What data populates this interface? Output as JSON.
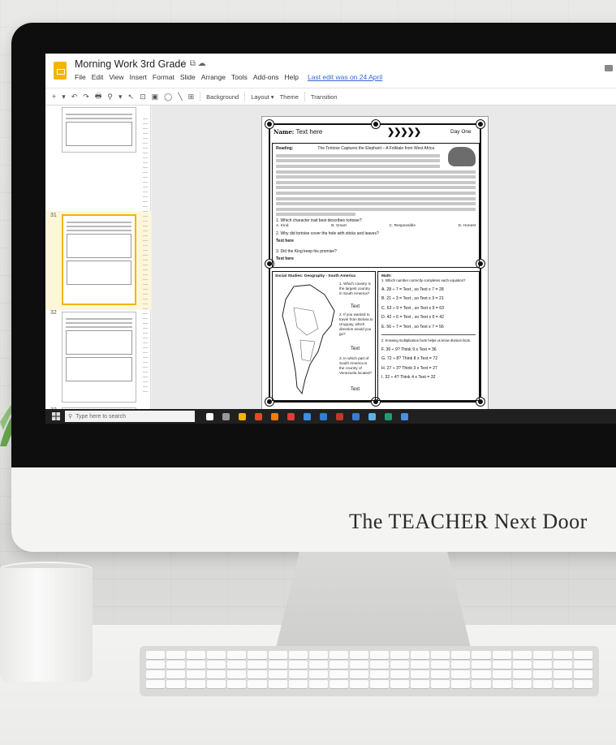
{
  "app": {
    "doc_title": "Morning Work 3rd Grade",
    "title_icons": "☆  ⧉  ☁",
    "menu": [
      "File",
      "Edit",
      "View",
      "Insert",
      "Format",
      "Slide",
      "Arrange",
      "Tools",
      "Add-ons",
      "Help"
    ],
    "last_edit": "Last edit was on 24 April"
  },
  "toolbar": {
    "icons": [
      "+",
      "▾",
      "↶",
      "↷",
      "🖶",
      "⚲",
      "▾",
      "↖",
      "⊡",
      "▣",
      "◯",
      "╲",
      "⊞"
    ],
    "background": "Background",
    "layout": "Layout ▾",
    "theme": "Theme",
    "transition": "Transition"
  },
  "filmstrip": {
    "slides": [
      {
        "number": "",
        "selected": false
      },
      {
        "number": "31",
        "selected": true
      },
      {
        "number": "32",
        "selected": false
      },
      {
        "number": "33",
        "selected": false
      }
    ],
    "view_icons": [
      "▬",
      "⊞"
    ]
  },
  "worksheet": {
    "name_label": "Name:",
    "name_value": "Text here",
    "arrows": "❯❯❯❯❯",
    "day": "Day One",
    "reading_label": "Reading:",
    "reading_title": "The Tortoise Captures the Elephant – A Folktale from West Africa",
    "q1": "1. Which character trait best describes tortoise?",
    "q1_choices": [
      "A. Kind",
      "B. Smart",
      "C. Responsible",
      "D. Honest"
    ],
    "q2": "2. Why did tortoise cover the hole with sticks and leaves?",
    "q2_answer": "Text here",
    "q3": "3. Did the King keep his promise?",
    "q3_answer": "Text here",
    "social_title": "Social Studies: Geography - South America",
    "social_q1": "1. Which country is the largest country in South America?",
    "social_q2": "2. If you wanted to travel from Bolivia to Uruguay, which direction would you go?",
    "social_q3": "3. In which part of South America is the country of Venezuela located?",
    "social_answer": "Text",
    "math_title": "Math:",
    "math_intro": "1. Which number correctly completes each equation?",
    "math_rows": [
      "A.  28 ÷ 7 = Text , so Text x 7 = 28",
      "B.  21 ÷ 3 = Text , so Text x 3 = 21",
      "C.  63 ÷ 9 = Text , so Text x 9 = 63",
      "D.  42 ÷ 6 = Text , so Text x 6 = 42",
      "E.  56 ÷ 7 = Text , so Text x 7 = 56"
    ],
    "math_intro2": "2. Knowing multiplication facts helps us know division facts.",
    "math_rows2": [
      "F.  36 ÷ 9?     Think  9 x Text = 36",
      "G.  72 ÷ 8?     Think  8 x Text = 72",
      "H.  27 ÷ 3?     Think  3 x Text = 27",
      "I.  32 ÷ 4?     Think  4 x Text = 32"
    ]
  },
  "taskbar": {
    "search_placeholder": "Type here to search",
    "tray_colors": [
      "#ffffff",
      "#999999",
      "#f4b400",
      "#e04b2a",
      "#ff7a00",
      "#e23b3b",
      "#3b8fe0",
      "#2f7fd6",
      "#c0392b",
      "#3a7bd5",
      "#5fb0e8",
      "#1e9e6e",
      "#4a90e2"
    ]
  },
  "branding": {
    "text": "The TEACHER Next Door"
  },
  "colors": {
    "slides_yellow": "#f4b400",
    "link_blue": "#3367d6",
    "taskbar": "#202020"
  }
}
